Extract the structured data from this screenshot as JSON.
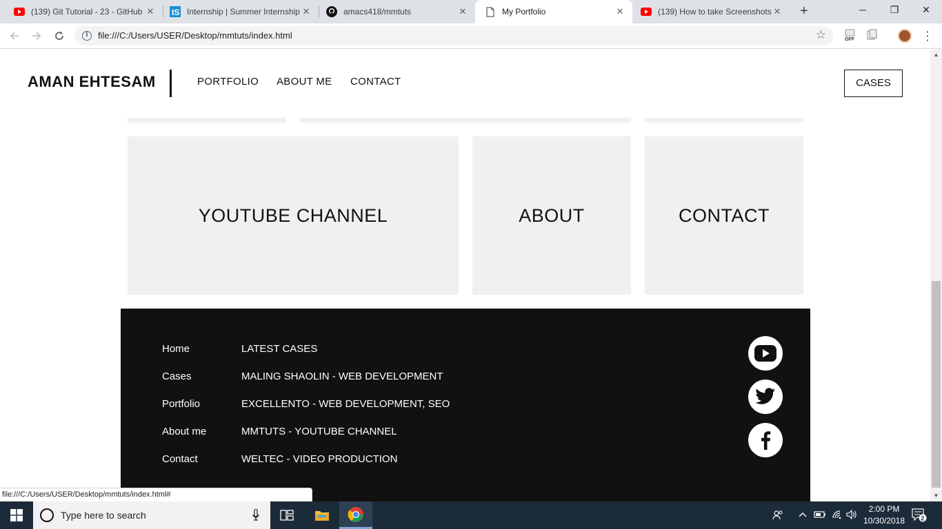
{
  "browser": {
    "tabs": [
      {
        "title": "(139) Git Tutorial - 23 - GitHub",
        "favicon": "youtube-icon"
      },
      {
        "title": "Internship | Summer Internship",
        "favicon": "internshala-icon"
      },
      {
        "title": "amacs418/mmtuts",
        "favicon": "github-icon"
      },
      {
        "title": "My Portfolio",
        "favicon": "page-icon",
        "active": true
      },
      {
        "title": "(139) How to take Screenshots",
        "favicon": "youtube-icon"
      }
    ],
    "url": "file:///C:/Users/USER/Desktop/mmtuts/index.html",
    "status_url": "file:///C:/Users/USER/Desktop/mmtuts/index.html#"
  },
  "site": {
    "logo": "AMAN EHTESAM",
    "nav": [
      "PORTFOLIO",
      "ABOUT ME",
      "CONTACT"
    ],
    "cta": "CASES",
    "cards": [
      "YOUTUBE CHANNEL",
      "ABOUT",
      "CONTACT"
    ]
  },
  "footer": {
    "links": [
      "Home",
      "Cases",
      "Portfolio",
      "About me",
      "Contact"
    ],
    "cases": [
      "LATEST CASES",
      "MALING SHAOLIN - WEB DEVELOPMENT",
      "EXCELLENTO - WEB DEVELOPMENT, SEO",
      "MMTUTS - YOUTUBE CHANNEL",
      "WELTEC - VIDEO PRODUCTION"
    ],
    "social": [
      "youtube-icon",
      "twitter-icon",
      "facebook-icon"
    ]
  },
  "taskbar": {
    "search_placeholder": "Type here to search",
    "time": "2:00 PM",
    "date": "10/30/2018",
    "notifications": "2"
  },
  "colors": {
    "footer_bg": "#111111",
    "card_bg": "#f0f0f0",
    "taskbar_bg": "#1c2b3a"
  }
}
